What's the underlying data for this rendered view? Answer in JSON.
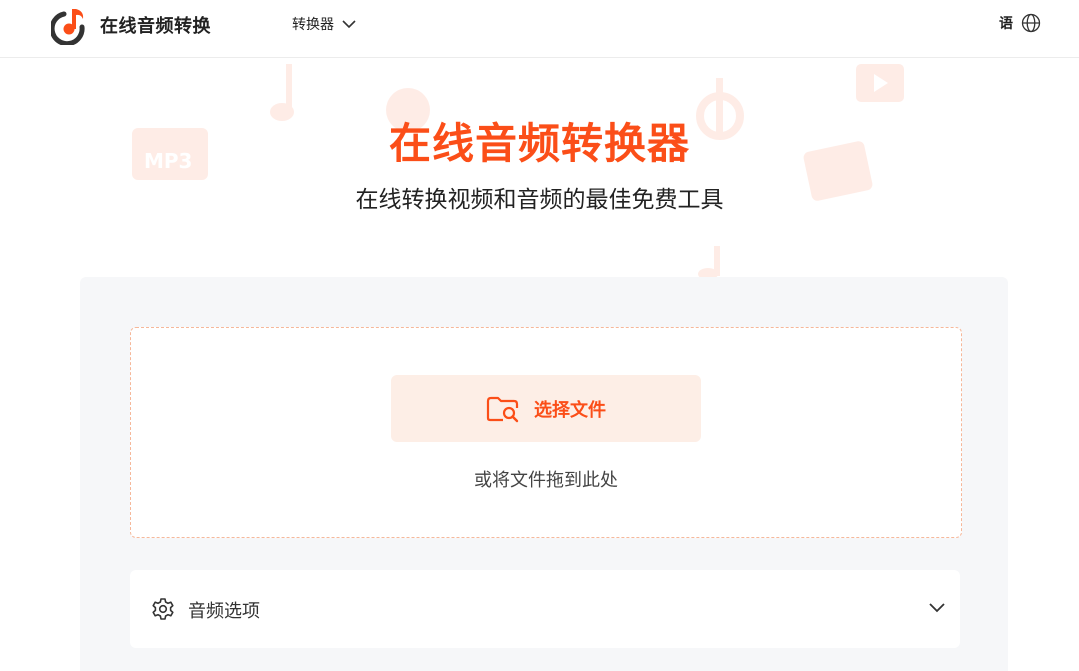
{
  "header": {
    "app_name": "在线音频转换",
    "nav_converter": "转换器",
    "language": "语"
  },
  "hero": {
    "title": "在线音频转换器",
    "subtitle": "在线转换视频和音频的最佳免费工具"
  },
  "upload": {
    "select_button": "选择文件",
    "drop_hint": "或将文件拖到此处"
  },
  "options": {
    "label": "音频选项"
  },
  "colors": {
    "accent": "#fb4e18",
    "accent_soft": "#fdeee6",
    "panel_bg": "#f6f7f9"
  },
  "icons": {
    "logo": "music-note-disc-icon",
    "nav_chevron": "chevron-down-icon",
    "language": "globe-icon",
    "select": "folder-search-icon",
    "options": "gear-icon",
    "options_chevron": "chevron-down-icon"
  }
}
